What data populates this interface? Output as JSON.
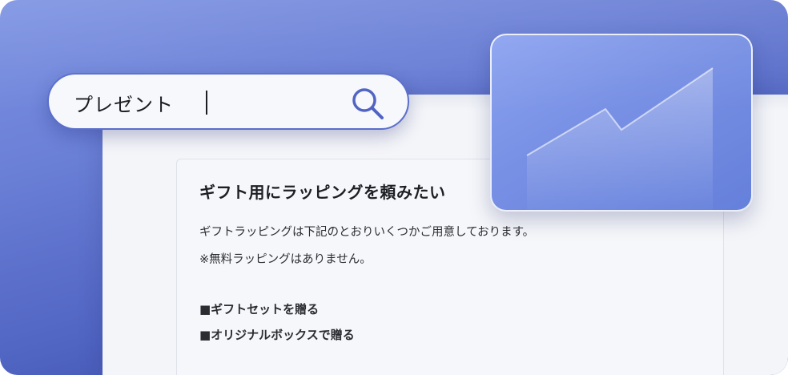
{
  "search": {
    "query": "プレゼント",
    "icon": "search-icon"
  },
  "faq": {
    "title": "ギフト用にラッピングを頼みたい",
    "body_line_1": "ギフトラッピングは下記のとおりいくつかご用意しております。",
    "body_line_2": "※無料ラッピングはありません。",
    "option_1": "■ギフトセットを贈る",
    "option_2": "■オリジナルボックスで贈る"
  },
  "chart_card": {
    "icon": "trend-chart-icon"
  },
  "colors": {
    "background_top": "#7e94e3",
    "background_bottom": "#2c3c94",
    "accent": "#5a6ecc",
    "page": "#f4f5f9"
  }
}
